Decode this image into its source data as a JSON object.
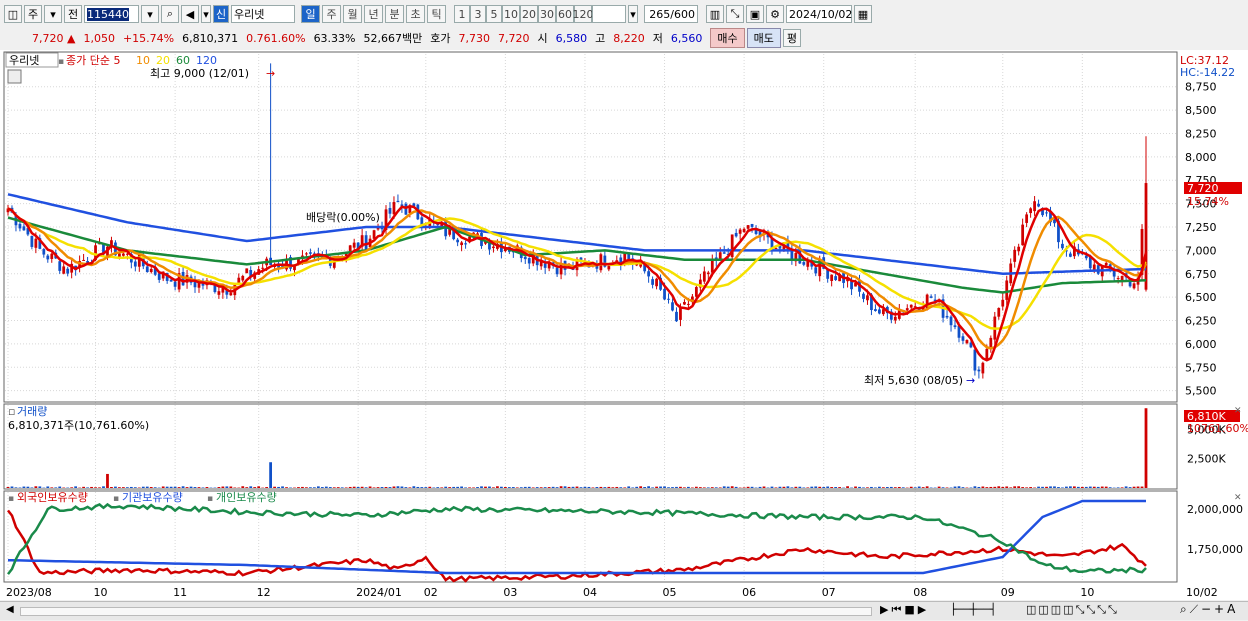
{
  "toolbar": {
    "market_label": "주",
    "prev_label": "전",
    "code": "115440",
    "badge": "신",
    "name": "우리넷",
    "periods": [
      "일",
      "주",
      "월",
      "년",
      "분",
      "초",
      "틱"
    ],
    "minute_units": [
      "1",
      "3",
      "5",
      "10",
      "20",
      "30",
      "60",
      "120"
    ],
    "count": "265",
    "count_max": "/600",
    "date": "2024/10/02",
    "icons": [
      "window-icon",
      "dropdown-icon",
      "search-icon",
      "speaker-icon",
      "chart-tool-icon",
      "save-icon",
      "gear-icon",
      "calendar-icon"
    ]
  },
  "quote": {
    "price": "7,720",
    "change": "1,050",
    "rate": "+15.74%",
    "volume": "6,810,371",
    "vol_rate": "0.761.60%",
    "ratio": "63.33%",
    "amount": "52,667백만",
    "hoga_label": "호가",
    "ask": "7,730",
    "bid": "7,720",
    "open_label": "시",
    "open": "6,580",
    "high_label": "고",
    "high": "8,220",
    "low_label": "저",
    "low": "6,560",
    "buy_label": "매수",
    "sell_label": "매도",
    "eval_label": "평"
  },
  "colors": {
    "up": "#d00000",
    "down": "#1050c8",
    "ma5": "#e00000",
    "ma10": "#f08c00",
    "ma20": "#f5e000",
    "ma60": "#1a8a3a",
    "ma120": "#2050e0"
  },
  "chart_data": [
    {
      "type": "candlestick",
      "title": "우리넷",
      "legend": [
        "종가 단순 5",
        "10",
        "20",
        "60",
        "120"
      ],
      "lc": "LC:37.12",
      "hc": "HC:-14.22",
      "y_ticks": [
        5500,
        5750,
        6000,
        6250,
        6500,
        6750,
        7000,
        7250,
        7500,
        7750,
        8000,
        8250,
        8500,
        8750
      ],
      "ylim": [
        5400,
        9100
      ],
      "x_ticks": [
        "2023/08",
        "10",
        "11",
        "12",
        "2024/01",
        "02",
        "03",
        "04",
        "05",
        "06",
        "07",
        "08",
        "09",
        "10",
        "10/02"
      ],
      "last_price_label": "7,720",
      "last_rate_label": "15.74%",
      "annotations": {
        "high": "최고 9,000 (12/01)",
        "low": "최저 5,630 (08/05)",
        "dividend": "배당락(0.00%)"
      },
      "close_anchors": [
        [
          0,
          7450
        ],
        [
          8,
          7000
        ],
        [
          15,
          6800
        ],
        [
          25,
          7050
        ],
        [
          40,
          6700
        ],
        [
          55,
          6600
        ],
        [
          65,
          6850
        ],
        [
          80,
          6900
        ],
        [
          90,
          7100
        ],
        [
          98,
          7500
        ],
        [
          110,
          7200
        ],
        [
          125,
          7050
        ],
        [
          140,
          6800
        ],
        [
          155,
          6950
        ],
        [
          162,
          6700
        ],
        [
          168,
          6250
        ],
        [
          175,
          6700
        ],
        [
          185,
          7250
        ],
        [
          195,
          7000
        ],
        [
          210,
          6700
        ],
        [
          220,
          6300
        ],
        [
          232,
          6500
        ],
        [
          240,
          6100
        ],
        [
          244,
          5700
        ],
        [
          248,
          6250
        ],
        [
          258,
          7600
        ],
        [
          265,
          7050
        ],
        [
          272,
          6850
        ],
        [
          278,
          6750
        ],
        [
          284,
          6650
        ],
        [
          286,
          7720
        ]
      ],
      "ma60": [
        [
          0,
          7350
        ],
        [
          30,
          7000
        ],
        [
          60,
          6850
        ],
        [
          80,
          6950
        ],
        [
          90,
          7000
        ],
        [
          110,
          7250
        ],
        [
          130,
          6950
        ],
        [
          150,
          7000
        ],
        [
          170,
          6900
        ],
        [
          200,
          6900
        ],
        [
          220,
          6750
        ],
        [
          240,
          6600
        ],
        [
          250,
          6550
        ],
        [
          265,
          6650
        ],
        [
          286,
          6680
        ]
      ],
      "ma120": [
        [
          0,
          7600
        ],
        [
          30,
          7300
        ],
        [
          60,
          7100
        ],
        [
          90,
          7250
        ],
        [
          110,
          7250
        ],
        [
          130,
          7150
        ],
        [
          160,
          7000
        ],
        [
          200,
          7000
        ],
        [
          240,
          6800
        ],
        [
          250,
          6750
        ],
        [
          270,
          6780
        ],
        [
          286,
          6800
        ]
      ]
    },
    {
      "type": "bar",
      "title": "거래량",
      "summary": "6,810,371주(10,761.60%)",
      "y_ticks": [
        "2,500K",
        "5,000K"
      ],
      "last_label": "6,810K",
      "last_rate_label": "10761.60%",
      "values_note": "daily volumes, mostly below 300K",
      "spikes": [
        [
          25,
          1200
        ],
        [
          66,
          2200
        ],
        [
          286,
          6810
        ]
      ]
    },
    {
      "type": "line",
      "title": "외국인보유수량",
      "legend": [
        "외국인보유수량",
        "기관보유수량",
        "개인보유수량"
      ],
      "y_ticks": [
        "1,750,000",
        "2,000,000"
      ],
      "series": [
        {
          "name": "외국인보유수량",
          "anchors": [
            [
              0,
              2000000
            ],
            [
              8,
              1600000
            ],
            [
              30,
              1620000
            ],
            [
              60,
              1600000
            ],
            [
              90,
              1680000
            ],
            [
              98,
              1620000
            ],
            [
              105,
              1700000
            ],
            [
              110,
              1560000
            ],
            [
              140,
              1580000
            ],
            [
              170,
              1620000
            ],
            [
              200,
              1750000
            ],
            [
              220,
              1700000
            ],
            [
              250,
              1750000
            ],
            [
              265,
              1700000
            ],
            [
              280,
              1770000
            ],
            [
              286,
              1650000
            ]
          ]
        },
        {
          "name": "기관보유수량",
          "anchors": [
            [
              0,
              1680000
            ],
            [
              60,
              1650000
            ],
            [
              110,
              1600000
            ],
            [
              200,
              1600000
            ],
            [
              230,
              1600000
            ],
            [
              250,
              1700000
            ],
            [
              260,
              1950000
            ],
            [
              270,
              2050000
            ],
            [
              286,
              2050000
            ]
          ]
        },
        {
          "name": "개인보유수량",
          "anchors": [
            [
              0,
              1600000
            ],
            [
              10,
              2000000
            ],
            [
              30,
              2020000
            ],
            [
              60,
              1980000
            ],
            [
              90,
              1960000
            ],
            [
              110,
              2000000
            ],
            [
              160,
              1980000
            ],
            [
              200,
              1950000
            ],
            [
              230,
              1950000
            ],
            [
              250,
              1800000
            ],
            [
              260,
              1650000
            ],
            [
              270,
              1610000
            ],
            [
              286,
              1620000
            ]
          ]
        }
      ]
    }
  ]
}
